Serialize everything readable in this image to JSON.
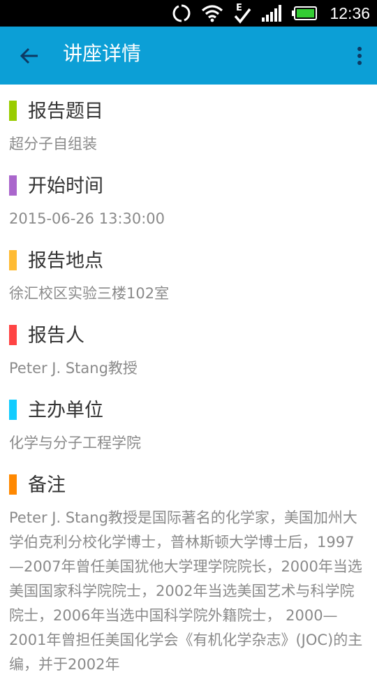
{
  "status_bar": {
    "time": "12:36",
    "icons": [
      "sync-icon",
      "wifi-icon",
      "check-badge-icon",
      "signal-icon",
      "battery-icon"
    ]
  },
  "app_bar": {
    "title": "讲座详情",
    "back_icon": "arrow-left-icon",
    "menu_icon": "more-vertical-icon",
    "background": "#0c9fd6"
  },
  "sections": [
    {
      "label": "报告题目",
      "value": "超分子自组装",
      "color": "#99cc00"
    },
    {
      "label": "开始时间",
      "value": "2015-06-26 13:30:00",
      "color": "#aa66cc"
    },
    {
      "label": "报告地点",
      "value": "徐汇校区实验三楼102室",
      "color": "#ffbb33"
    },
    {
      "label": "报告人",
      "value": "Peter J. Stang教授",
      "color": "#ff4444"
    },
    {
      "label": "主办单位",
      "value": "化学与分子工程学院",
      "color": "#11ccff"
    },
    {
      "label": "备注",
      "value": "Peter J. Stang教授是国际著名的化学家，美国加州大学伯克利分校化学博士，普林斯顿大学博士后，1997—2007年曾任美国犹他大学理学院院长，2000年当选美国国家科学院院士，2002年当选美国艺术与科学院院士，2006年当选中国科学院外籍院士， 2000—2001年曾担任美国化学会《有机化学杂志》(JOC)的主编，并于2002年",
      "color": "#ff8800"
    }
  ]
}
